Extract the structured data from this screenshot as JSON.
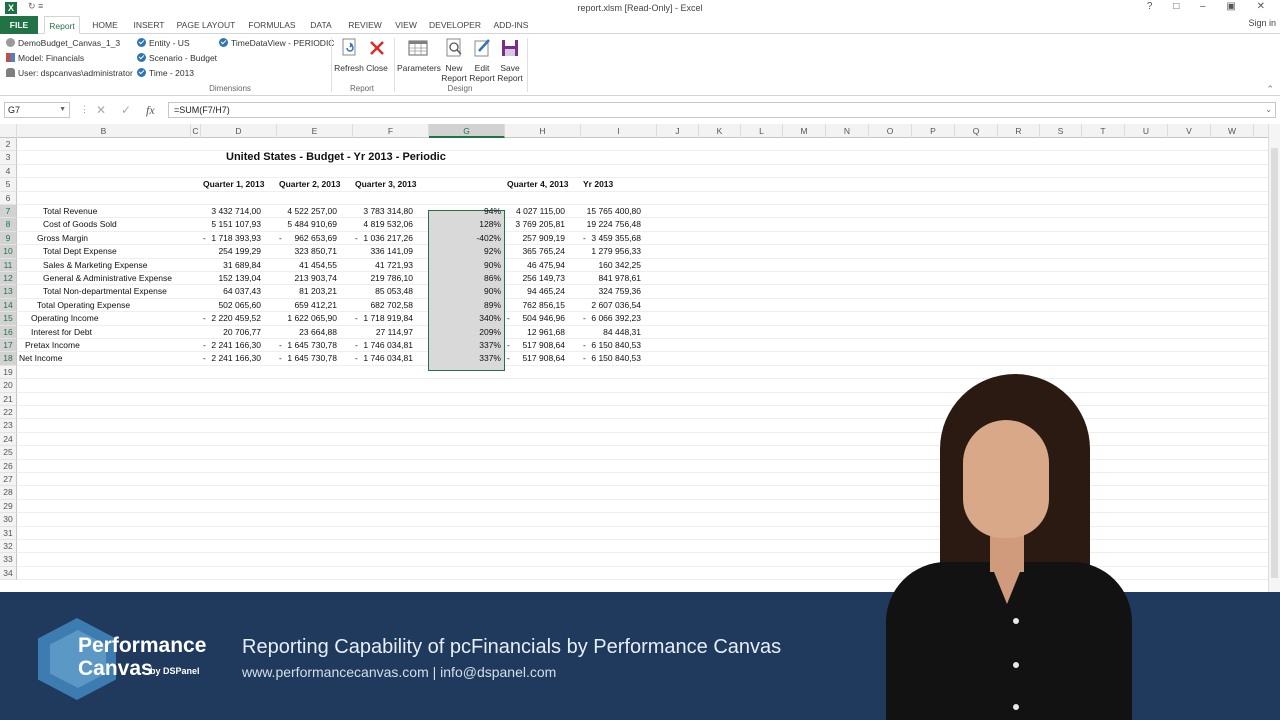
{
  "window": {
    "title": "report.xlsm  [Read-Only] - Excel",
    "qat": "↻  ≡",
    "controls": "?  □  –  ▣  ✕"
  },
  "tabs": [
    "FILE",
    "Report",
    "HOME",
    "INSERT",
    "PAGE LAYOUT",
    "FORMULAS",
    "DATA",
    "REVIEW",
    "VIEW",
    "DEVELOPER",
    "ADD-INS"
  ],
  "signin": "Sign in",
  "ribbon": {
    "connection": {
      "app": "DemoBudget_Canvas_1_3",
      "model": "Model: Financials",
      "user": "User: dspcanvas\\administrator"
    },
    "dimensions": {
      "entity": "Entity - US",
      "scenario": "Scenario - Budget",
      "time": "Time - 2013",
      "timeview": "TimeDataView - PERIODIC",
      "group": "Dimensions"
    },
    "report": {
      "refresh": "Refresh",
      "close": "Close",
      "group": "Report"
    },
    "design": {
      "parameters": "Parameters",
      "new1": "New",
      "new2": "Report",
      "edit1": "Edit",
      "edit2": "Report",
      "save1": "Save",
      "save2": "Report",
      "group": "Design"
    }
  },
  "formula_bar": {
    "cell": "G7",
    "formula": "=SUM(F7/H7)",
    "cancel": "✕",
    "enter": "✓",
    "fx": "fx"
  },
  "columns": [
    "B",
    "C",
    "D",
    "E",
    "F",
    "G",
    "H",
    "I",
    "J",
    "K",
    "L",
    "M",
    "N",
    "O",
    "P",
    "Q",
    "R",
    "S",
    "T",
    "U",
    "V",
    "W"
  ],
  "row_numbers": [
    "2",
    "3",
    "4",
    "5",
    "6",
    "7",
    "8",
    "9",
    "10",
    "11",
    "12",
    "13",
    "14",
    "15",
    "16",
    "17",
    "18",
    "19",
    "20",
    "21",
    "22",
    "23",
    "24",
    "25",
    "26",
    "27",
    "28",
    "29",
    "30",
    "31",
    "32",
    "33",
    "34"
  ],
  "sheet": {
    "title": "United States - Budget - Yr 2013 - Periodic",
    "headers": {
      "d": "Quarter 1, 2013",
      "e": "Quarter 2, 2013",
      "f": "Quarter 3, 2013",
      "h": "Quarter 4, 2013",
      "i": "Yr 2013"
    },
    "rows": [
      {
        "label": "Total Revenue",
        "d": "3 432 714,00",
        "e": "4 522 257,00",
        "f": "3 783 314,80",
        "g": "94%",
        "h": "4 027 115,00",
        "i": "15 765 400,80"
      },
      {
        "label": "Cost of Goods Sold",
        "d": "5 151 107,93",
        "e": "5 484 910,69",
        "f": "4 819 532,06",
        "g": "128%",
        "h": "3 769 205,81",
        "i": "19 224 756,48"
      },
      {
        "label": "Gross Margin",
        "d": "1 718 393,93",
        "e": "962 653,69",
        "f": "1 036 217,26",
        "g": "-402%",
        "h": "257 909,19",
        "i": "3 459 355,68"
      },
      {
        "label": "Total Dept Expense",
        "d": "254 199,29",
        "e": "323 850,71",
        "f": "336 141,09",
        "g": "92%",
        "h": "365 765,24",
        "i": "1 279 956,33"
      },
      {
        "label": "Sales & Marketing Expense",
        "d": "31 689,84",
        "e": "41 454,55",
        "f": "41 721,93",
        "g": "90%",
        "h": "46 475,94",
        "i": "160 342,25"
      },
      {
        "label": "General & Administrative Expense",
        "d": "152 139,04",
        "e": "213 903,74",
        "f": "219 786,10",
        "g": "86%",
        "h": "256 149,73",
        "i": "841 978,61"
      },
      {
        "label": "Total Non-departmental Expense",
        "d": "64 037,43",
        "e": "81 203,21",
        "f": "85 053,48",
        "g": "90%",
        "h": "94 465,24",
        "i": "324 759,36"
      },
      {
        "label": "Total Operating Expense",
        "d": "502 065,60",
        "e": "659 412,21",
        "f": "682 702,58",
        "g": "89%",
        "h": "762 856,15",
        "i": "2 607 036,54"
      },
      {
        "label": "Operating Income",
        "d": "2 220 459,52",
        "e": "1 622 065,90",
        "f": "1 718 919,84",
        "g": "340%",
        "h": "504 946,96",
        "i": "6 066 392,23"
      },
      {
        "label": "Interest for Debt",
        "d": "20 706,77",
        "e": "23 664,88",
        "f": "27 114,97",
        "g": "209%",
        "h": "12 961,68",
        "i": "84 448,31"
      },
      {
        "label": "Pretax Income",
        "d": "2 241 166,30",
        "e": "1 645 730,78",
        "f": "1 746 034,81",
        "g": "337%",
        "h": "517 908,64",
        "i": "6 150 840,53"
      },
      {
        "label": "Net Income",
        "d": "2 241 166,30",
        "e": "1 645 730,78",
        "f": "1 746 034,81",
        "g": "337%",
        "h": "517 908,64",
        "i": "6 150 840,53"
      }
    ],
    "minus": "-"
  },
  "banner": {
    "logo_line1": "Performance",
    "logo_line2": "Canvas",
    "logo_by": "by DSPanel",
    "headline": "Reporting Capability of pcFinancials by Performance Canvas",
    "contact": "www.performancecanvas.com   |   info@dspanel.com"
  },
  "colors": {
    "excel_green": "#217346",
    "banner": "#1f3a5c",
    "selection": "#d9d9d9"
  }
}
